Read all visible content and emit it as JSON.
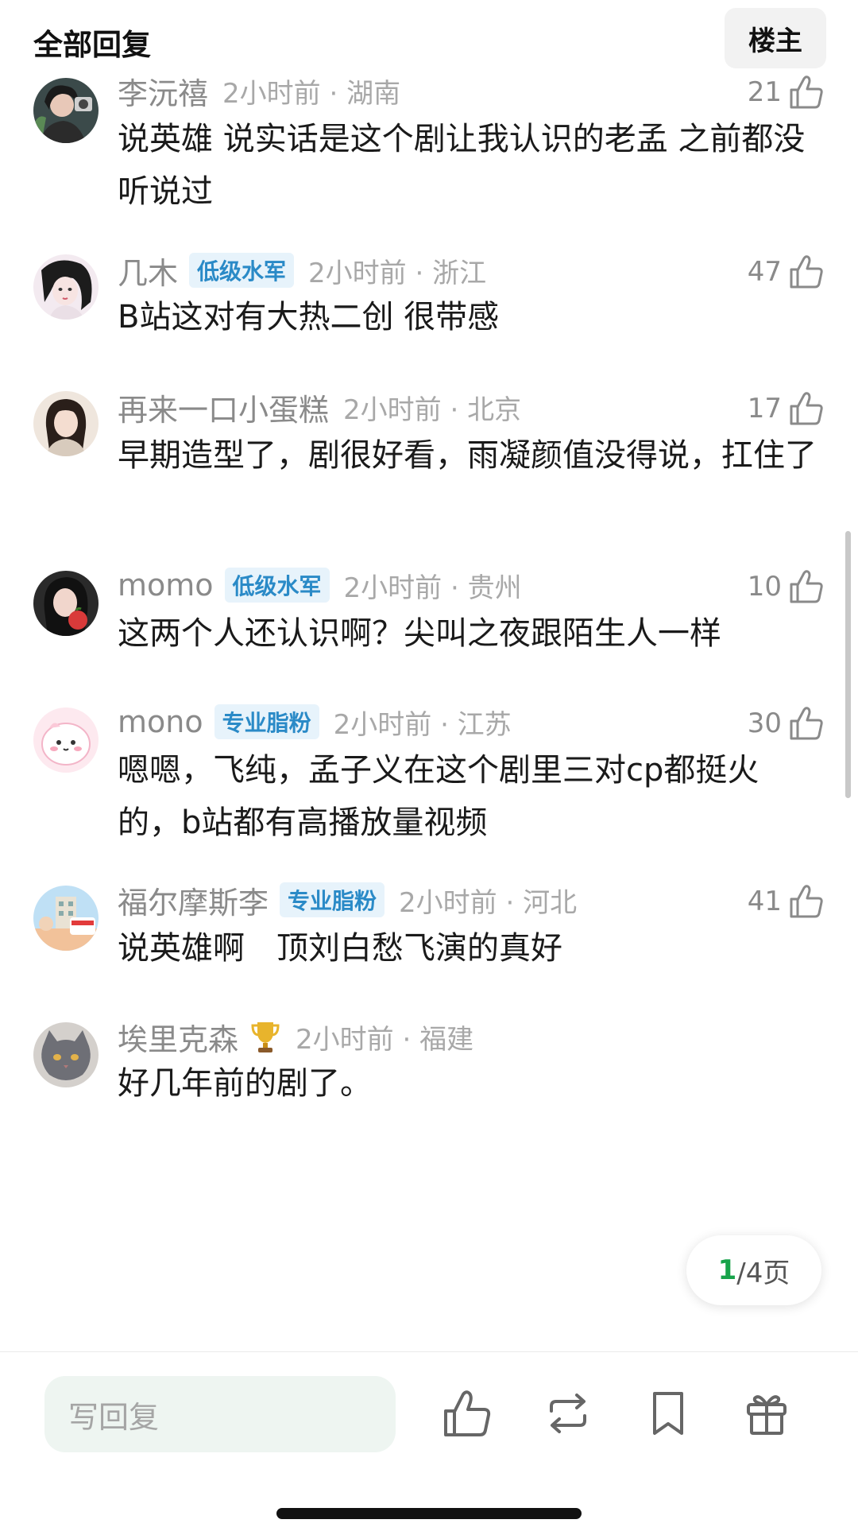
{
  "header": {
    "title": "全部回复",
    "owner_button": "楼主"
  },
  "comments": [
    {
      "username": "李沅禧",
      "badge": "",
      "time": "2小时前 · 湖南",
      "likes": "21",
      "content": "说英雄 说实话是这个剧让我认识的老孟 之前都没听说过",
      "avatar_icon": "avatar-photo"
    },
    {
      "username": "几木",
      "badge": "低级水军",
      "time": "2小时前 · 浙江",
      "likes": "47",
      "content": "B站这对有大热二创 很带感",
      "avatar_icon": "avatar-illustration"
    },
    {
      "username": "再来一口小蛋糕",
      "badge": "",
      "time": "2小时前 · 北京",
      "likes": "17",
      "content": "早期造型了，剧很好看，雨凝颜值没得说，扛住了",
      "avatar_icon": "avatar-photo"
    },
    {
      "username": "momo",
      "badge": "低级水军",
      "time": "2小时前 · 贵州",
      "likes": "10",
      "content": "这两个人还认识啊？尖叫之夜跟陌生人一样",
      "avatar_icon": "avatar-photo"
    },
    {
      "username": "mono",
      "badge": "专业脂粉",
      "time": "2小时前 · 江苏",
      "likes": "30",
      "content": "嗯嗯，飞纯，孟子义在这个剧里三对cp都挺火的，b站都有高播放量视频",
      "avatar_icon": "avatar-cartoon"
    },
    {
      "username": "福尔摩斯李",
      "badge": "专业脂粉",
      "time": "2小时前 · 河北",
      "likes": "41",
      "content": "说英雄啊　顶刘白愁飞演的真好",
      "avatar_icon": "avatar-poster"
    },
    {
      "username": "埃里克森",
      "badge": "",
      "time": "2小时前 · 福建",
      "likes": "",
      "content": "好几年前的剧了。",
      "avatar_icon": "avatar-cat"
    }
  ],
  "pagination": {
    "current": "1",
    "rest": "/4页"
  },
  "bottom_bar": {
    "reply_placeholder": "写回复",
    "actions": [
      "like-icon",
      "repost-icon",
      "bookmark-icon",
      "gift-icon"
    ]
  },
  "colors": {
    "badge_text": "#2a8ac7",
    "badge_bg": "#e7f3fb",
    "page_current": "#17a34a",
    "reply_bg": "#eef5f1"
  }
}
